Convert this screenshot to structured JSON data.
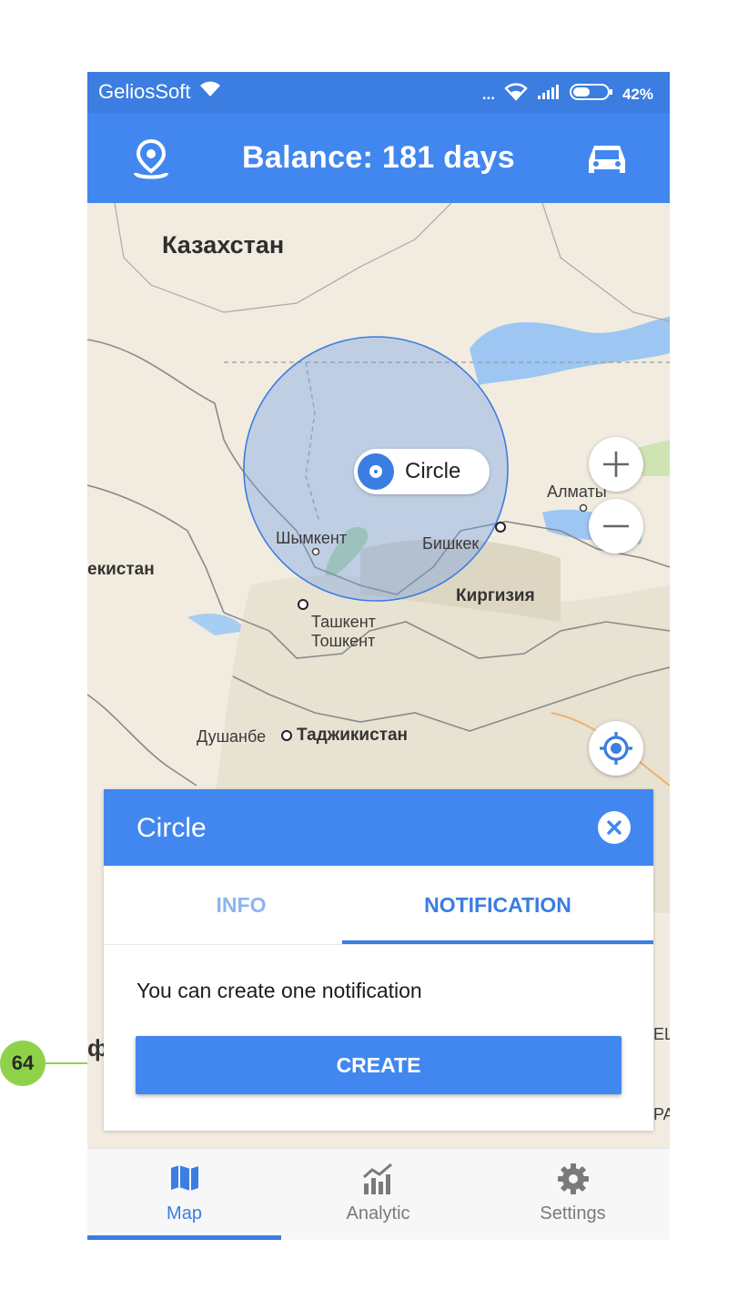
{
  "status_bar": {
    "carrier": "GeliosSoft",
    "dots": "...",
    "battery": "42%"
  },
  "header": {
    "title": "Balance: 181 days",
    "left_icon": "location-pin-icon",
    "right_icon": "car-icon"
  },
  "map": {
    "labels": {
      "kazakhstan": "Казахстан",
      "uzbekistan": "екистан",
      "shymkent": "Шымкент",
      "bishkek": "Бишкек",
      "almaty": "Алматы",
      "kyrgyzstan": "Киргизия",
      "tashkent_ru": "Ташкент",
      "tashkent_uz": "Тошкент",
      "dushanbe": "Душанбе",
      "tajikistan": "Таджикистан",
      "edge_left": "ф",
      "edge_right_1": "EL",
      "edge_right_2": "PA"
    },
    "geofence_name": "Circle",
    "controls": [
      "zoom-in",
      "zoom-out",
      "my-location"
    ]
  },
  "panel": {
    "title": "Circle",
    "tabs": [
      {
        "label": "INFO",
        "active": false
      },
      {
        "label": "NOTIFICATION",
        "active": true
      }
    ],
    "message": "You can create one notification",
    "create_label": "CREATE"
  },
  "bottom_nav": {
    "items": [
      {
        "label": "Map",
        "icon": "map-icon",
        "active": true
      },
      {
        "label": "Analytic",
        "icon": "analytics-icon",
        "active": false
      },
      {
        "label": "Settings",
        "icon": "gear-icon",
        "active": false
      }
    ]
  },
  "annotation": {
    "number": "64"
  },
  "colors": {
    "primary": "#4287ef",
    "status_bar": "#3b7de0",
    "annotation": "#8fd24a"
  }
}
